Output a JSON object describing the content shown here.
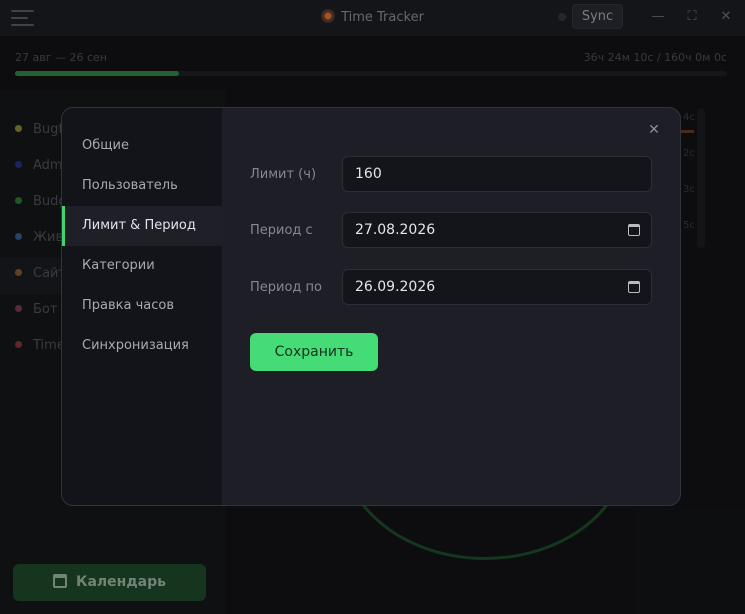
{
  "titlebar": {
    "title": "Time Tracker",
    "sync_label": "Sync",
    "minimize": "—",
    "maximize": "⛶",
    "close": "✕"
  },
  "header": {
    "period": "27 авг — 26 сен",
    "time_summary": "36ч 24м 10с / 160ч 0м 0с",
    "progress_fraction": 0.23
  },
  "background_list": [
    {
      "label": "Bugf",
      "color": "#8a8a3a"
    },
    {
      "label": "Adm",
      "color": "#2b2f8f"
    },
    {
      "label": "Budg",
      "color": "#2a7a35"
    },
    {
      "label": "Жив",
      "color": "#3a5a8a"
    },
    {
      "label": "Сайт",
      "color": "#8a5a2a"
    },
    {
      "label": "Бот д",
      "color": "#7a3a5a"
    },
    {
      "label": "Time",
      "color": "#8a3535"
    }
  ],
  "background_right": [
    "4с",
    "2с",
    "3с",
    "5с"
  ],
  "calendar_button": "Календарь",
  "modal": {
    "nav": [
      "Общие",
      "Пользователь",
      "Лимит & Период",
      "Категории",
      "Правка часов",
      "Синхронизация"
    ],
    "active_index": 2,
    "close": "✕",
    "fields": {
      "limit_label": "Лимит (ч)",
      "limit_value": "160",
      "from_label": "Период с",
      "from_value": "27.08.2026",
      "to_label": "Период по",
      "to_value": "26.09.2026"
    },
    "save_label": "Сохранить"
  },
  "colors": {
    "accent": "#45db77",
    "progress": "#2d8a42"
  }
}
